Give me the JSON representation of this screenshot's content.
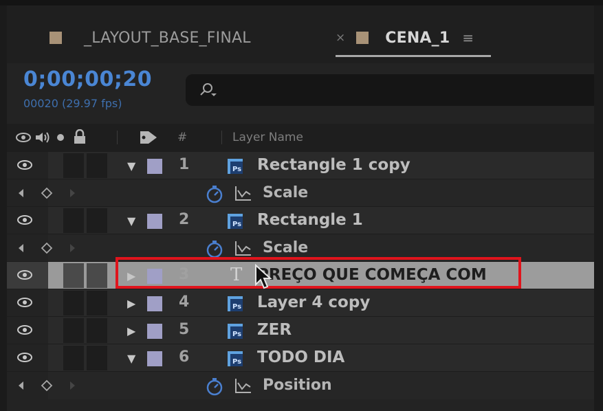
{
  "tabs": [
    {
      "label": "_LAYOUT_BASE_FINAL",
      "swatch_color": "#a89277",
      "active": false
    },
    {
      "label": "CENA_1",
      "swatch_color": "#a89277",
      "active": true
    }
  ],
  "tab_close_glyph": "×",
  "tab_menu_glyph": "≡",
  "timecode": "0;00;00;20",
  "frame_rate_text": "00020 (29.97 fps)",
  "search": {
    "placeholder": "",
    "icon": "search-icon"
  },
  "header": {
    "number_label": "#",
    "layer_name_label": "Layer Name"
  },
  "rows": [
    {
      "kind": "layer",
      "number": "1",
      "name": "Rectangle 1 copy",
      "icon": "photoshop-layer-icon",
      "expanded": true,
      "label_color": "#a09fc6"
    },
    {
      "kind": "property",
      "name": "Scale"
    },
    {
      "kind": "layer",
      "number": "2",
      "name": "Rectangle 1",
      "icon": "photoshop-layer-icon",
      "expanded": true,
      "label_color": "#a09fc6"
    },
    {
      "kind": "property",
      "name": "Scale"
    },
    {
      "kind": "layer",
      "number": "3",
      "name": "PREÇO QUE COMEÇA COM",
      "icon": "text-layer-icon",
      "expanded": false,
      "selected": true,
      "label_color": "#a09fc6"
    },
    {
      "kind": "layer",
      "number": "4",
      "name": "Layer 4 copy",
      "icon": "photoshop-layer-icon",
      "expanded": false,
      "label_color": "#a09fc6"
    },
    {
      "kind": "layer",
      "number": "5",
      "name": "ZER",
      "icon": "photoshop-layer-icon",
      "expanded": false,
      "label_color": "#a09fc6"
    },
    {
      "kind": "layer",
      "number": "6",
      "name": "TODO DIA",
      "icon": "photoshop-layer-icon",
      "expanded": true,
      "label_color": "#a09fc6"
    },
    {
      "kind": "property",
      "name": "Position"
    }
  ],
  "colors": {
    "timecode": "#4a86d4",
    "highlight_box": "#e0141c",
    "label": "#a09fc6"
  }
}
